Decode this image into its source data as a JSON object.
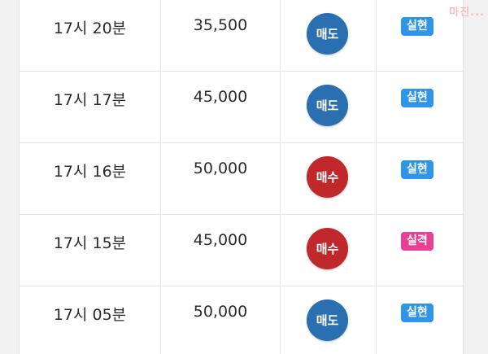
{
  "colors": {
    "sell": "#2a6fb0",
    "buy": "#c0282c",
    "realized": "#2f95e8",
    "lost": "#ea3f93"
  },
  "watermark": "마진...",
  "trades": [
    {
      "time": "17시 20분",
      "price": "35,500",
      "type": "매도",
      "type_kind": "sell",
      "result": "실현",
      "result_kind": "realized"
    },
    {
      "time": "17시 17분",
      "price": "45,000",
      "type": "매도",
      "type_kind": "sell",
      "result": "실현",
      "result_kind": "realized"
    },
    {
      "time": "17시 16분",
      "price": "50,000",
      "type": "매수",
      "type_kind": "buy",
      "result": "실현",
      "result_kind": "realized"
    },
    {
      "time": "17시 15분",
      "price": "45,000",
      "type": "매수",
      "type_kind": "buy",
      "result": "실격",
      "result_kind": "lost"
    },
    {
      "time": "17시 05분",
      "price": "50,000",
      "type": "매도",
      "type_kind": "sell",
      "result": "실현",
      "result_kind": "realized"
    }
  ]
}
